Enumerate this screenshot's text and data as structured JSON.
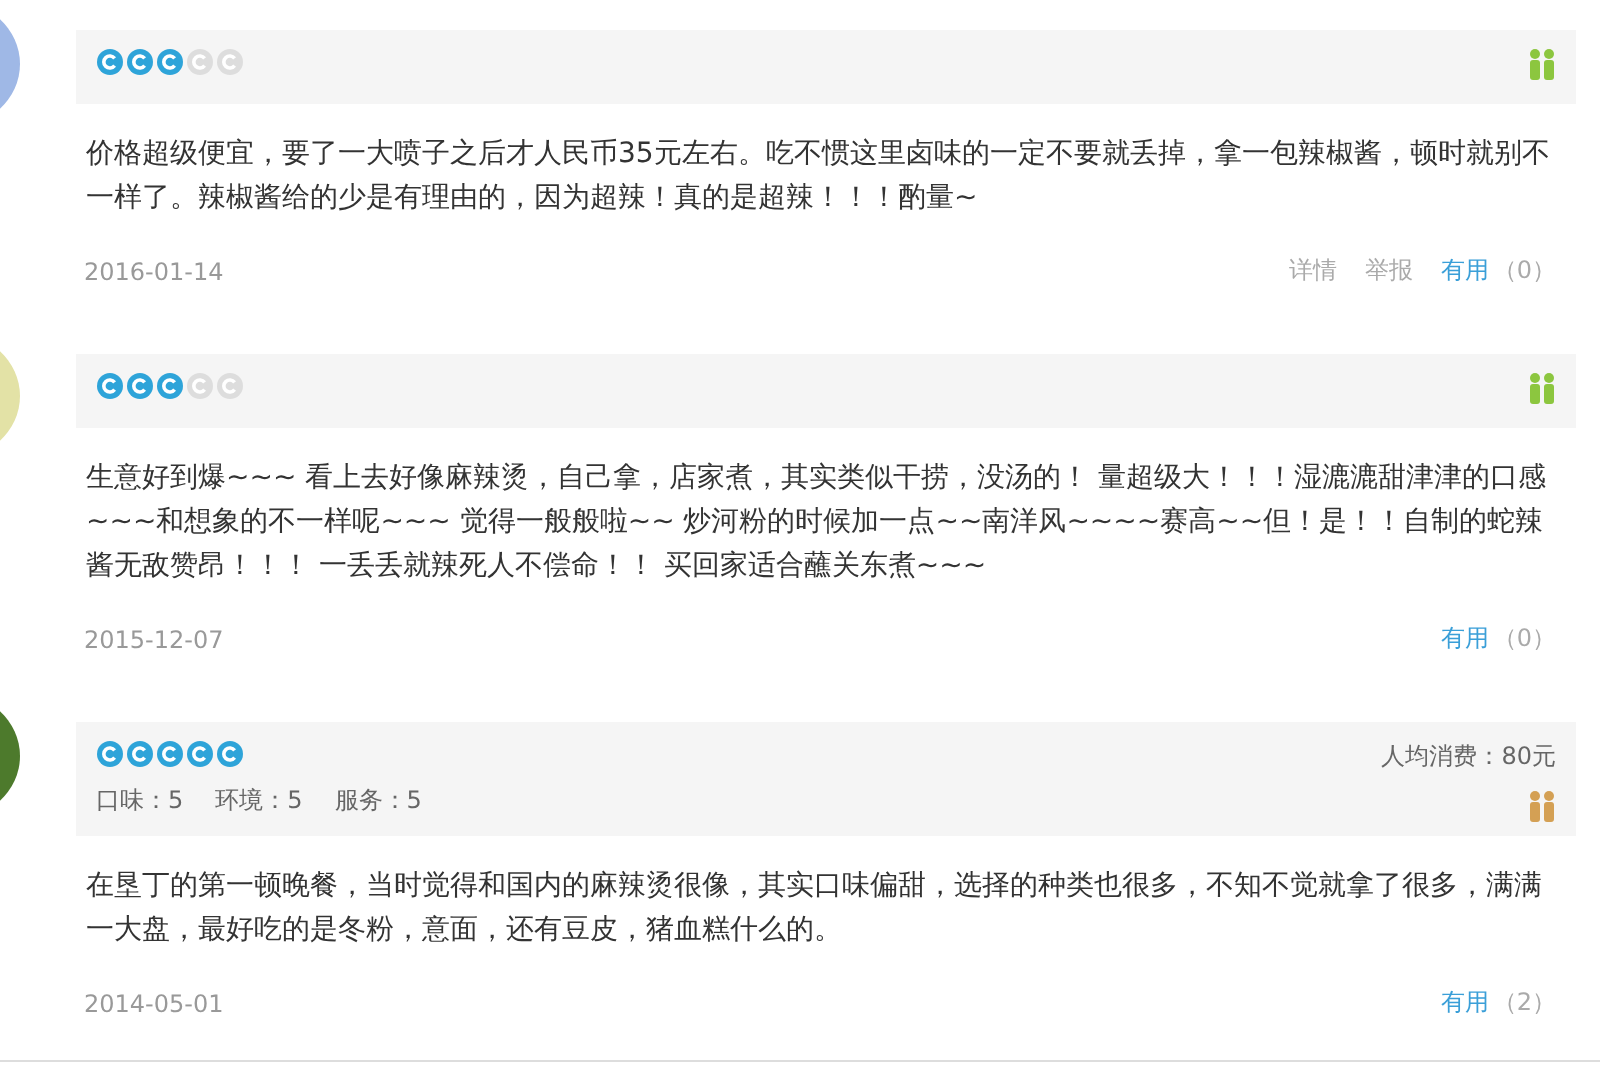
{
  "reviews": [
    {
      "color": "#9fb8e6",
      "stars": 3,
      "badge": {
        "color": "#8cc63f"
      },
      "text": "价格超级便宜，要了一大喷子之后才人民币35元左右。吃不惯这里卤味的一定不要就丢掉，拿一包辣椒酱，顿时就别不一样了。辣椒酱给的少是有理由的，因为超辣！真的是超辣！！！酌量~",
      "date": "2016-01-14",
      "links": [
        {
          "label": "详情"
        },
        {
          "label": "举报"
        }
      ],
      "useful": {
        "label": "有用",
        "count": "（0）"
      }
    },
    {
      "color": "#e3e2a6",
      "stars": 3,
      "badge": {
        "color": "#8cc63f"
      },
      "text": "生意好到爆~~~ 看上去好像麻辣烫，自己拿，店家煮，其实类似干捞，没汤的！ 量超级大！！！湿漉漉甜津津的口感~~~和想象的不一样呢~~~ 觉得一般般啦~~ 炒河粉的时候加一点~~南洋风~~~~赛高~~但！是！！自制的蛇辣酱无敌赞昂！！！ 一丢丢就辣死人不偿命！！ 买回家适合蘸关东煮~~~",
      "date": "2015-12-07",
      "useful": {
        "label": "有用",
        "count": "（0）"
      }
    },
    {
      "color": "#4d7a2c",
      "stars": 5,
      "scores": [
        "口味：5",
        "环境：5",
        "服务：5"
      ],
      "price": "人均消费：80元",
      "badge": {
        "color": "#d4a054"
      },
      "text": "在垦丁的第一顿晚餐，当时觉得和国内的麻辣烫很像，其实口味偏甜，选择的种类也很多，不知不觉就拿了很多，满满一大盘，最好吃的是冬粉，意面，还有豆皮，猪血糕什么的。",
      "date": "2014-05-01",
      "useful": {
        "label": "有用",
        "count": "（2）"
      }
    }
  ]
}
